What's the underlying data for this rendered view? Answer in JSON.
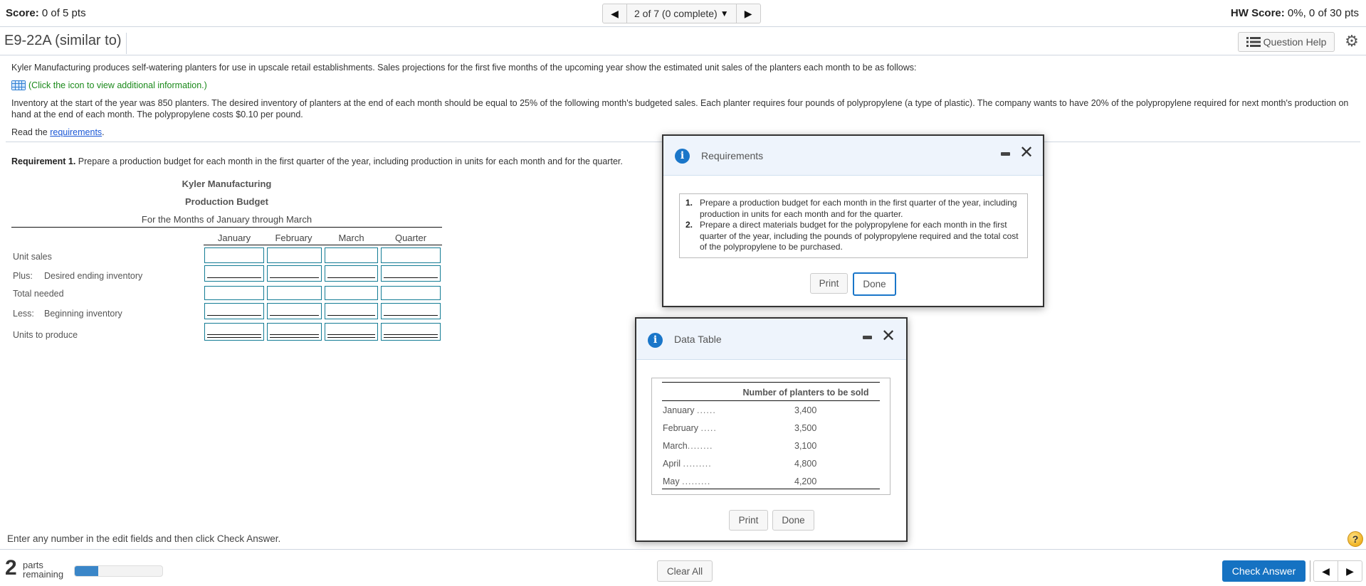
{
  "header": {
    "score_label": "Score:",
    "score_value": "0 of 5 pts",
    "question_nav": "2 of 7 (0 complete)",
    "hw_score_label": "HW Score:",
    "hw_score_value": "0%, 0 of 30 pts",
    "prev_icon": "triangle-left-icon",
    "next_icon": "triangle-right-icon",
    "dropdown_icon": "caret-down-icon"
  },
  "title_bar": {
    "question_title": "E9-22A (similar to)",
    "question_help_label": "Question Help",
    "settings_icon": "gear-icon"
  },
  "problem": {
    "intro": "Kyler Manufacturing produces self-watering planters for use in upscale retail establishments. Sales projections for the first five months of the upcoming year show the estimated unit sales of the planters each month to be as follows:",
    "info_link": "(Click the icon to view additional information.)",
    "details": "Inventory at the start of the year was 850 planters. The desired inventory of planters at the end of each month should be equal to 25% of the following month's budgeted sales. Each planter requires four pounds of polypropylene (a type of plastic). The company wants to have 20% of the polypropylene required for next month's production on hand at the end of each month. The polypropylene costs $0.10 per pound.",
    "read_prefix": "Read the ",
    "read_link": "requirements",
    "read_suffix": "."
  },
  "requirement1": {
    "label": "Requirement 1.",
    "text": " Prepare a production budget for each month in the first quarter of the year, including production in units for each month and for the quarter."
  },
  "budget": {
    "company": "Kyler Manufacturing",
    "title": "Production Budget",
    "period": "For the Months of January through March",
    "columns": [
      "January",
      "February",
      "March",
      "Quarter"
    ],
    "rows": [
      {
        "prefix": "",
        "label": "Unit sales",
        "values": [
          "",
          "",
          "",
          ""
        ]
      },
      {
        "prefix": "Plus:",
        "label": "Desired ending inventory",
        "values": [
          "",
          "",
          "",
          ""
        ]
      },
      {
        "prefix": "",
        "label": "Total needed",
        "values": [
          "",
          "",
          "",
          ""
        ]
      },
      {
        "prefix": "Less:",
        "label": "Beginning inventory",
        "values": [
          "",
          "",
          "",
          ""
        ]
      },
      {
        "prefix": "",
        "label": "Units to produce",
        "values": [
          "",
          "",
          "",
          ""
        ]
      }
    ]
  },
  "requirements_dialog": {
    "title": "Requirements",
    "items": [
      {
        "num": "1.",
        "text": "Prepare a production budget for each month in the first quarter of the year, including production in units for each month and for the quarter."
      },
      {
        "num": "2.",
        "text": "Prepare a direct materials budget for the polypropylene for each month in the first quarter of the year, including the pounds of polypropylene required and the total cost of the polypropylene to be purchased."
      }
    ],
    "print_label": "Print",
    "done_label": "Done"
  },
  "data_table_dialog": {
    "title": "Data Table",
    "column_header": "Number of planters to be sold",
    "rows": [
      {
        "month": "January",
        "dots": "......",
        "value": "3,400"
      },
      {
        "month": "February",
        "dots": ".....",
        "value": "3,500"
      },
      {
        "month": "March",
        "dots": "........",
        "value": "3,100"
      },
      {
        "month": "April",
        "dots": ".........",
        "value": "4,800"
      },
      {
        "month": "May",
        "dots": ".........",
        "value": "4,200"
      }
    ],
    "print_label": "Print",
    "done_label": "Done"
  },
  "footer": {
    "hint": "Enter any number in the edit fields and then click Check Answer.",
    "parts_count": "2",
    "parts_line1": "parts",
    "parts_line2": "remaining",
    "progress_fraction": 0.27,
    "clear_all_label": "Clear All",
    "check_answer_label": "Check Answer",
    "help_icon": "question-mark-icon"
  },
  "colors": {
    "accent_blue": "#1572c2",
    "input_border": "#137c95",
    "info_link_green": "#1b8a1b",
    "link_blue": "#1a57d6"
  }
}
